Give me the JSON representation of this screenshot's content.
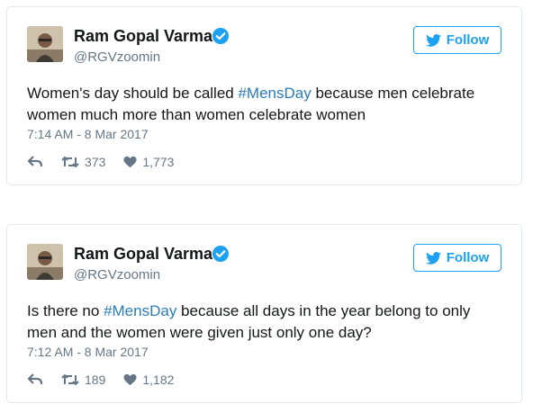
{
  "tweets": [
    {
      "author_name": "Ram Gopal Varma",
      "handle": "@RGVzoomin",
      "follow_label": "Follow",
      "text_before": "Women's day should be called ",
      "hashtag": "#MensDay",
      "text_after": " because men celebrate women much more than women celebrate women",
      "timestamp": "7:14 AM - 8 Mar 2017",
      "retweets": "373",
      "likes": "1,773"
    },
    {
      "author_name": "Ram Gopal Varma",
      "handle": "@RGVzoomin",
      "follow_label": "Follow",
      "text_before": "Is there no ",
      "hashtag": "#MensDay",
      "text_after": " because all days in the year belong to only men and the women were given just only one day?",
      "timestamp": "7:12 AM - 8 Mar 2017",
      "retweets": "189",
      "likes": "1,182"
    }
  ],
  "colors": {
    "accent": "#1da1f2",
    "hashtag": "#2b7bb9",
    "muted": "#657786",
    "border": "#e1e8ed"
  },
  "icons": [
    "verified-badge-icon",
    "twitter-bird-icon",
    "reply-icon",
    "retweet-icon",
    "heart-icon"
  ]
}
